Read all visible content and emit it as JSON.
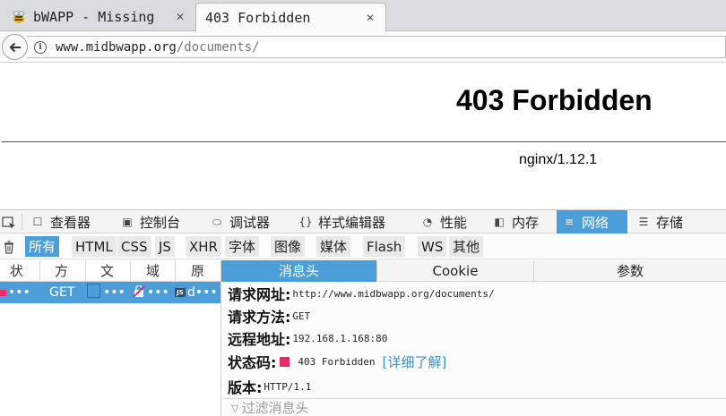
{
  "browser": {
    "tabs": [
      {
        "title": "bWAPP - Missing",
        "active": false,
        "favicon": "bee-icon"
      },
      {
        "title": "403 Forbidden",
        "active": true
      }
    ],
    "close_glyph": "✕",
    "url_domain": "www.midbwapp.org",
    "url_path": "/documents/",
    "info_glyph": "i"
  },
  "page": {
    "heading": "403 Forbidden",
    "server": "nginx/1.12.1"
  },
  "devtools": {
    "tabs": [
      {
        "label": "查看器",
        "icon": "☐"
      },
      {
        "label": "控制台",
        "icon": "▣"
      },
      {
        "label": "调试器",
        "icon": "⬭"
      },
      {
        "label": "样式编辑器",
        "icon": "{}"
      },
      {
        "label": "性能",
        "icon": "◔"
      },
      {
        "label": "内存",
        "icon": "◧"
      },
      {
        "label": "网络",
        "icon": "≡",
        "selected": true
      },
      {
        "label": "存储",
        "icon": "☰"
      }
    ],
    "filters": [
      "所有",
      "HTML",
      "CSS",
      "JS",
      "XHR",
      "字体",
      "图像",
      "媒体",
      "Flash",
      "WS",
      "其他"
    ],
    "selected_filter": "所有",
    "columns": [
      "状",
      "方",
      "文",
      "域",
      "原"
    ],
    "request": {
      "status": "•••",
      "method": "GET",
      "file": "•••",
      "domain": "•••",
      "cause": "d•••",
      "cause_badge": "JS"
    },
    "detail_tabs": [
      "消息头",
      "Cookie",
      "参数"
    ],
    "selected_detail_tab": "消息头",
    "headers": {
      "request_url_label": "请求网址:",
      "request_url": "http://www.midbwapp.org/documents/",
      "request_method_label": "请求方法:",
      "request_method": "GET",
      "remote_address_label": "远程地址:",
      "remote_address": "192.168.1.168:80",
      "status_code_label": "状态码:",
      "status_code": "403 Forbidden",
      "learn_more": "[详细了解]",
      "version_label": "版本:",
      "version": "HTTP/1.1"
    },
    "filter_headers_placeholder": "过滤消息头",
    "filter_glyph": "▽"
  },
  "colors": {
    "accent": "#4c9ed9",
    "status_error": "#ea2a6c",
    "link": "#3a8fd0"
  }
}
